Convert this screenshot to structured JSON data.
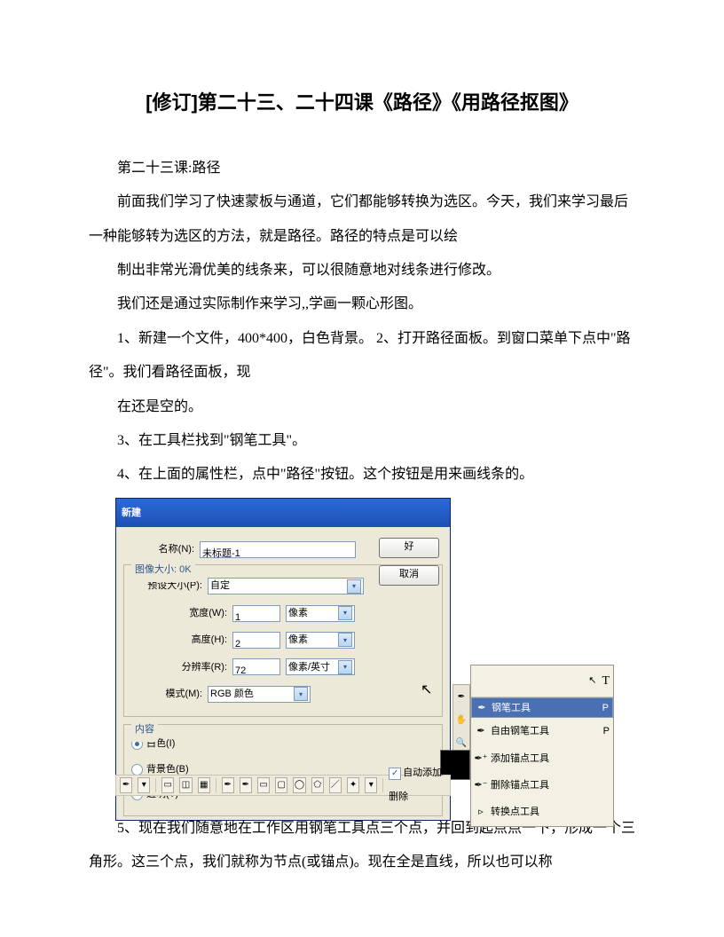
{
  "title": "[修订]第二十三、二十四课《路径》《用路径抠图》",
  "paragraphs": {
    "p1": "第二十三课:路径",
    "p2": "前面我们学习了快速蒙板与通道，它们都能够转换为选区。今天，我们来学习最后一种能够转为选区的方法，就是路径。路径的特点是可以绘",
    "p3": "制出非常光滑优美的线条来，可以很随意地对线条进行修改。",
    "p4": "我们还是通过实际制作来学习,,学画一颗心形图。",
    "p5": "1、新建一个文件，400*400，白色背景。 2、打开路径面板。到窗口菜单下点中\"路径\"。我们看路径面板，现",
    "p6": "在还是空的。",
    "p7": "3、在工具栏找到\"钢笔工具\"。",
    "p8": "4、在上面的属性栏，点中\"路径\"按钮。这个按钮是用来画线条的。",
    "p9": "5、现在我们随意地在工作区用钢笔工具点三个点，并回到起点点一下，形成一个三角形。这三个点，我们就称为节点(或锚点)。现在全是直线，所以也可以称"
  },
  "dialog": {
    "window_title": "新建",
    "labels": {
      "name": "名称(N):",
      "preset": "预设大小(P):",
      "width": "宽度(W):",
      "height": "高度(H):",
      "res": "分辨率(R):",
      "mode": "模式(M):",
      "image_size_legend": "图像大小: 0K",
      "contents_legend": "内容"
    },
    "values": {
      "name": "未标题-1",
      "preset": "自定",
      "width": "1",
      "height": "2",
      "res": "72",
      "mode": "RGB 颜色"
    },
    "units": {
      "width": "像素",
      "height": "像素",
      "res": "像素/英寸"
    },
    "buttons": {
      "ok": "好",
      "cancel": "取消"
    },
    "radios": {
      "white": "白色(I)",
      "bg": "背景色(B)",
      "trans": "透明(T)"
    }
  },
  "flyout": {
    "items": [
      {
        "icon": "✒",
        "label": "钢笔工具",
        "key": "P",
        "selected": true
      },
      {
        "icon": "✒",
        "label": "自由钢笔工具",
        "key": "P",
        "selected": false
      },
      {
        "icon": "✒⁺",
        "label": "添加锚点工具",
        "key": "",
        "selected": false
      },
      {
        "icon": "✒⁻",
        "label": "删除锚点工具",
        "key": "",
        "selected": false
      },
      {
        "icon": "▹",
        "label": "转换点工具",
        "key": "",
        "selected": false
      }
    ]
  },
  "optbar": {
    "auto_label": "自动添加/删除"
  }
}
